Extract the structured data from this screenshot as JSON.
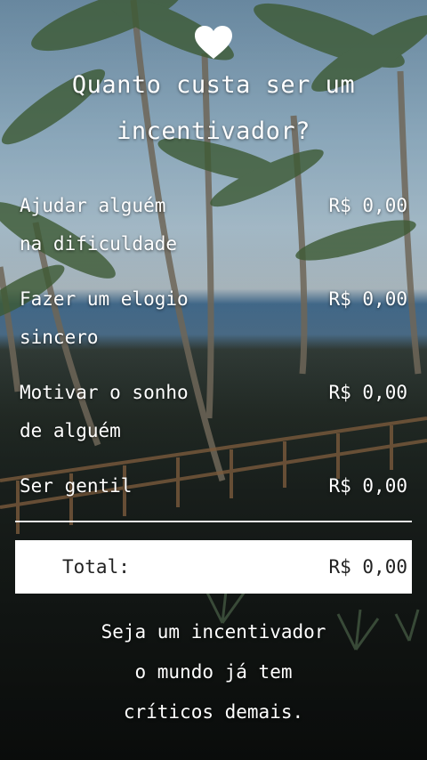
{
  "title_line1": "Quanto custa ser um",
  "title_line2": "incentivador?",
  "items": [
    {
      "label_line1": "Ajudar alguém",
      "label_line2": "na dificuldade",
      "price": "R$ 0,00"
    },
    {
      "label_line1": "Fazer um elogio",
      "label_line2": "sincero",
      "price": "R$ 0,00"
    },
    {
      "label_line1": "Motivar o sonho",
      "label_line2": "de alguém",
      "price": "R$ 0,00"
    },
    {
      "label_line1": "Ser gentil",
      "label_line2": "",
      "price": "R$ 0,00"
    }
  ],
  "total": {
    "label": "Total:",
    "value": "R$ 0,00"
  },
  "footer": {
    "line1": "Seja um incentivador",
    "line2": "o mundo já tem",
    "line3": "críticos demais."
  },
  "icons": {
    "top": "heart-icon"
  },
  "colors": {
    "text": "#ffffff",
    "total_bg": "#ffffff",
    "total_text": "#222222"
  }
}
